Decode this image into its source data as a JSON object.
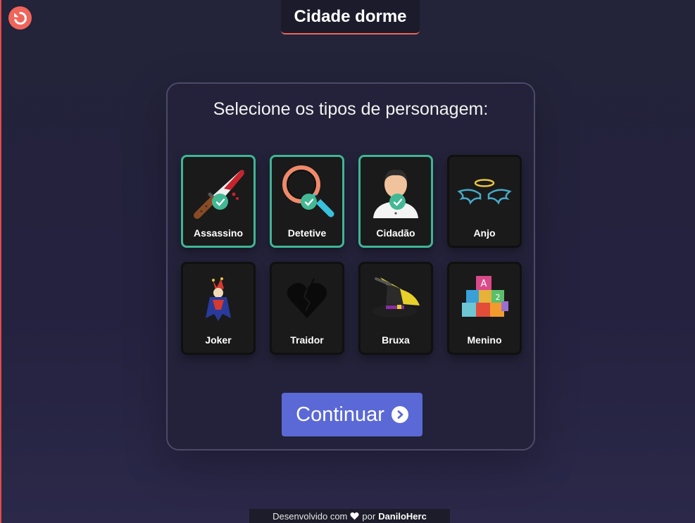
{
  "header": {
    "title": "Cidade dorme",
    "back_icon": "undo-icon"
  },
  "panel": {
    "heading": "Selecione os tipos de personagem:",
    "cards": [
      {
        "label": "Assassino",
        "icon": "bloody-knife-icon",
        "selected": true
      },
      {
        "label": "Detetive",
        "icon": "magnifier-icon",
        "selected": true
      },
      {
        "label": "Cidadão",
        "icon": "citizen-icon",
        "selected": true
      },
      {
        "label": "Anjo",
        "icon": "halo-wings-icon",
        "selected": false
      },
      {
        "label": "Joker",
        "icon": "joker-icon",
        "selected": false
      },
      {
        "label": "Traidor",
        "icon": "broken-heart-icon",
        "selected": false
      },
      {
        "label": "Bruxa",
        "icon": "witch-hat-icon",
        "selected": false
      },
      {
        "label": "Menino",
        "icon": "toy-blocks-icon",
        "selected": false
      }
    ],
    "continue_label": "Continuar",
    "continue_icon": "chevron-circle-right-icon"
  },
  "footer": {
    "prefix": "Desenvolvido com",
    "heart_icon": "heart-icon",
    "middle": "por",
    "author": "DaniloHerc"
  },
  "colors": {
    "accent_red": "#f0655a",
    "selected_border": "#3fb595",
    "button_blue": "#5a69d6",
    "background": "#232339"
  }
}
